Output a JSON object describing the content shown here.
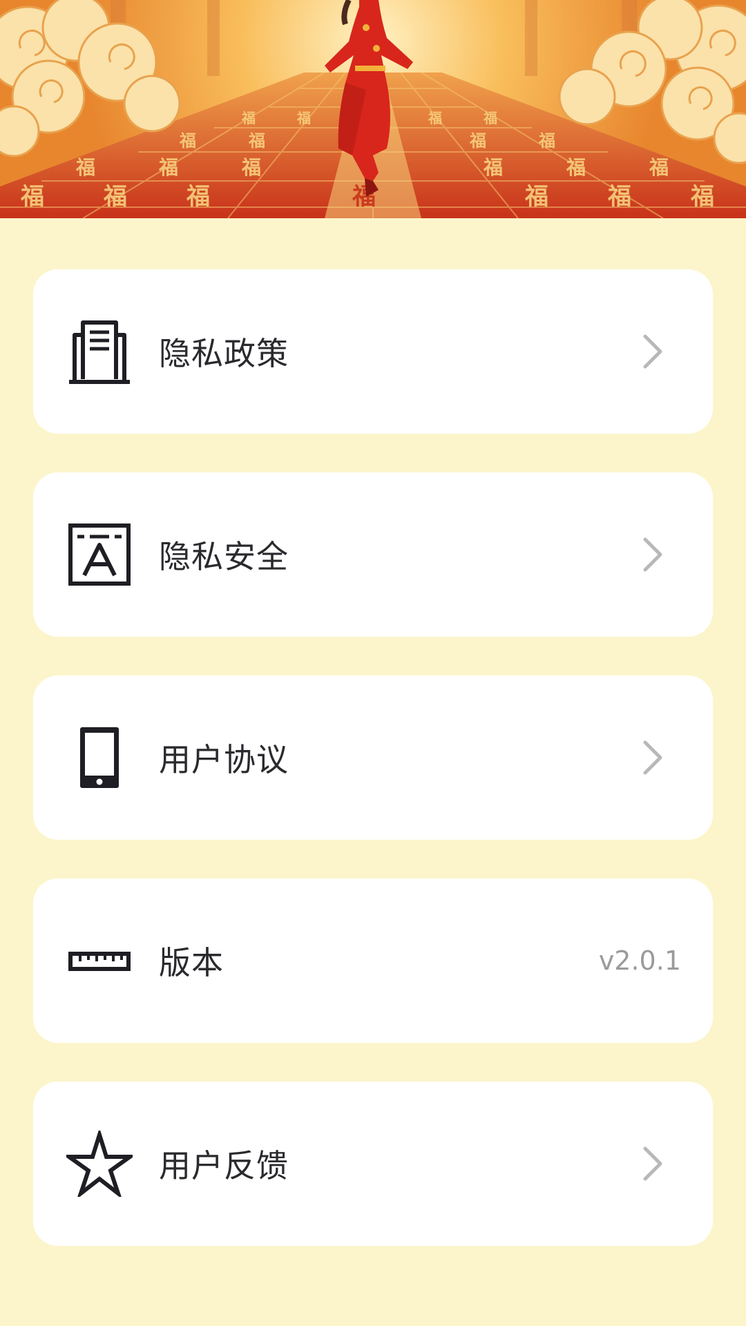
{
  "banner": {
    "image": "new-year-banner",
    "pattern_char": "福"
  },
  "menu": {
    "items": [
      {
        "label": "隐私政策",
        "icon": "document-stack-icon",
        "action": "chevron-right"
      },
      {
        "label": "隐私安全",
        "icon": "text-frame-icon",
        "action": "chevron-right"
      },
      {
        "label": "用户协议",
        "icon": "phone-icon",
        "action": "chevron-right"
      },
      {
        "label": "版本",
        "icon": "ruler-icon",
        "value": "v2.0.1"
      },
      {
        "label": "用户反馈",
        "icon": "star-icon",
        "action": "chevron-right"
      }
    ]
  },
  "colors": {
    "background": "#fcf5cb",
    "card": "#ffffff",
    "text": "#2a2a2e",
    "muted": "#9a9a9a",
    "chevron": "#b8b8b8"
  }
}
